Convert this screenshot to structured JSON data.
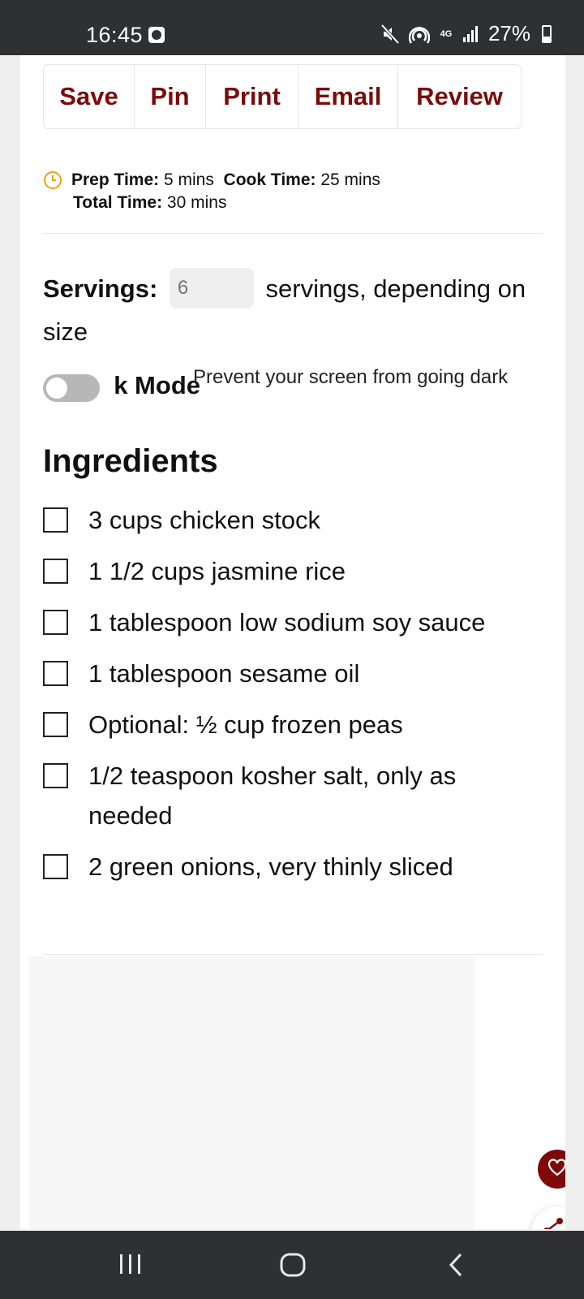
{
  "status_bar": {
    "time": "16:45",
    "network": "4G",
    "battery": "27%"
  },
  "actions": [
    "Save",
    "Pin",
    "Print",
    "Email",
    "Review"
  ],
  "times": {
    "prep_label": "Prep Time:",
    "prep_value": "5 mins",
    "cook_label": "Cook Time:",
    "cook_value": "25 mins",
    "total_label": "Total Time:",
    "total_value": "30 mins"
  },
  "servings": {
    "label": "Servings:",
    "value": "6",
    "suffix": "servings, depending on size"
  },
  "cook_mode": {
    "label": "k Mode",
    "description": "Prevent your screen from going dark",
    "enabled": false
  },
  "ingredients": {
    "title": "Ingredients",
    "items": [
      "3 cups chicken stock",
      "1 1/2 cups jasmine rice",
      "1 tablespoon low sodium soy sauce",
      "1 tablespoon sesame oil",
      "Optional: ½ cup frozen peas",
      "1/2 teaspoon kosher salt, only as needed",
      "2 green onions, very thinly sliced"
    ]
  },
  "colors": {
    "accent": "#7a0c0c",
    "clock_icon": "#e8a317",
    "system_bar": "#2f3033"
  },
  "icons": {
    "status": [
      "alarm-icon",
      "mute-icon",
      "hotspot-icon",
      "signal-icon",
      "battery-icon"
    ],
    "fabs": [
      "heart-icon",
      "share-icon"
    ],
    "nav": [
      "recents-icon",
      "home-icon",
      "back-icon"
    ]
  }
}
